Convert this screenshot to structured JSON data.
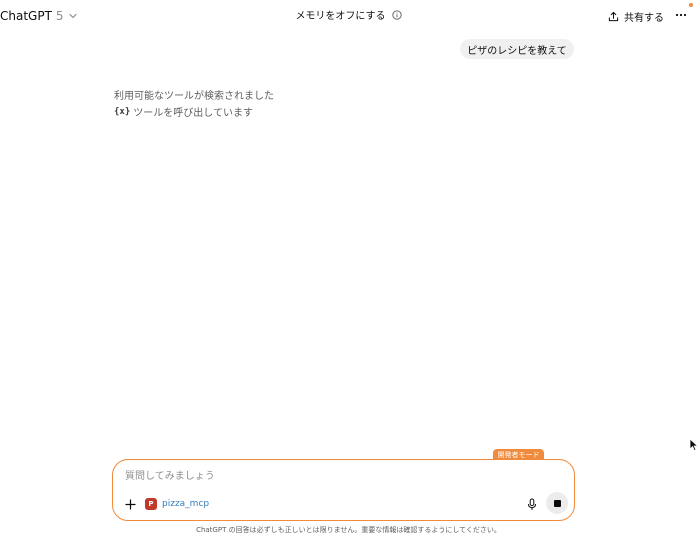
{
  "header": {
    "model_name": "ChatGPT",
    "model_version": "5",
    "memory_toggle_label": "メモリをオフにする",
    "share_label": "共有する"
  },
  "conversation": {
    "user_message": "ピザのレシピを教えて",
    "status_tools_found": "利用可能なツールが検索されました",
    "status_calling_tool_prefix": "{x}",
    "status_calling_tool": "ツールを呼び出しています"
  },
  "composer": {
    "dev_mode_badge": "開発者モード",
    "placeholder": "質問してみましょう",
    "tool_icon_letter": "P",
    "tool_name": "pizza_mcp"
  },
  "footer": {
    "disclaimer": "ChatGPT の回答は必ずしも正しいとは限りません。重要な情報は確認するようにしてください。"
  },
  "colors": {
    "accent": "#f08a3c",
    "tool_link": "#2f7ec2",
    "tool_icon_bg": "#c0392b"
  },
  "icons": {
    "model_chevron": "chevron-down-icon",
    "info": "info-icon",
    "share": "share-icon",
    "more": "more-horizontal-icon",
    "plus": "plus-icon",
    "mic": "mic-icon",
    "stop": "stop-icon",
    "cursor": "mouse-cursor-icon"
  }
}
